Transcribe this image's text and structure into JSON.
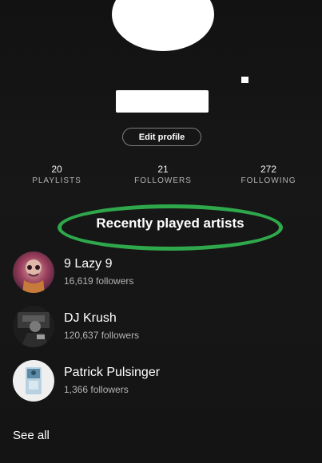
{
  "profile": {
    "edit_label": "Edit profile"
  },
  "stats": [
    {
      "value": "20",
      "label": "PLAYLISTS"
    },
    {
      "value": "21",
      "label": "FOLLOWERS"
    },
    {
      "value": "272",
      "label": "FOLLOWING"
    }
  ],
  "section": {
    "title": "Recently played artists",
    "highlight_color": "#2ea84b"
  },
  "artists": [
    {
      "name": "9 Lazy 9",
      "followers": "16,619 followers",
      "avatar": "9-lazy-9-avatar"
    },
    {
      "name": "DJ Krush",
      "followers": "120,637 followers",
      "avatar": "dj-krush-avatar"
    },
    {
      "name": "Patrick Pulsinger",
      "followers": "1,366 followers",
      "avatar": "patrick-pulsinger-avatar"
    }
  ],
  "footer": {
    "see_all_label": "See all"
  },
  "colors": {
    "background": "#141414",
    "text": "#ffffff",
    "muted_text": "#b3b3b3"
  }
}
